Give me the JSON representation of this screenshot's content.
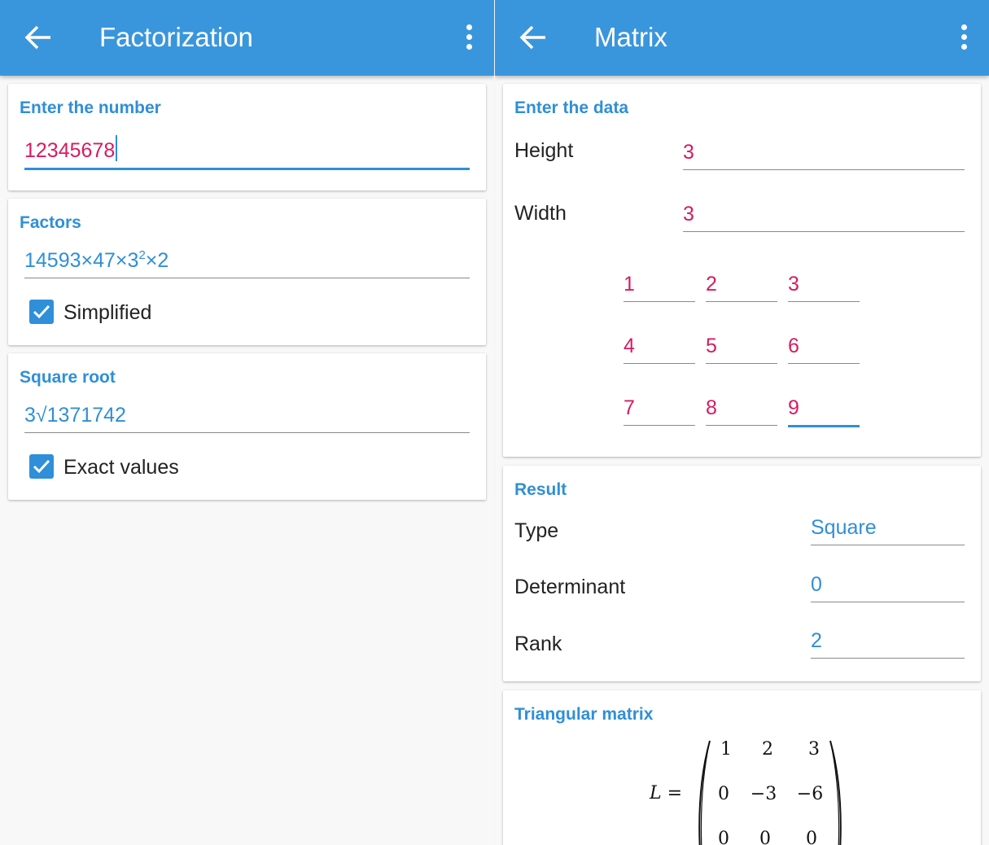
{
  "factorization": {
    "title": "Factorization",
    "input_card": {
      "title": "Enter the number",
      "value": "12345678"
    },
    "factors_card": {
      "title": "Factors",
      "value_pre": "14593×47×3",
      "value_sup": "2",
      "value_post": "×2",
      "checkbox_label": "Simplified",
      "checkbox_checked": true
    },
    "sqrt_card": {
      "title": "Square root",
      "value": "3√1371742",
      "checkbox_label": "Exact values",
      "checkbox_checked": true
    }
  },
  "matrix": {
    "title": "Matrix",
    "data_card": {
      "title": "Enter the data",
      "height_label": "Height",
      "height_value": "3",
      "width_label": "Width",
      "width_value": "3",
      "cells": [
        [
          "1",
          "2",
          "3"
        ],
        [
          "4",
          "5",
          "6"
        ],
        [
          "7",
          "8",
          "9"
        ]
      ]
    },
    "result_card": {
      "title": "Result",
      "type_label": "Type",
      "type_value": "Square",
      "det_label": "Determinant",
      "det_value": "0",
      "rank_label": "Rank",
      "rank_value": "2"
    },
    "triangular_card": {
      "title": "Triangular matrix",
      "lhs": "L =",
      "rows": [
        [
          "1",
          "2",
          "3"
        ],
        [
          "0",
          "−3",
          "−6"
        ],
        [
          "0",
          "0",
          "0"
        ]
      ]
    }
  },
  "colors": {
    "appbar": "#3a96dc",
    "accent": "#2f8fd8",
    "input_text": "#d81b60"
  },
  "icons": [
    "arrow-back-icon",
    "more-vert-icon",
    "check-icon"
  ]
}
